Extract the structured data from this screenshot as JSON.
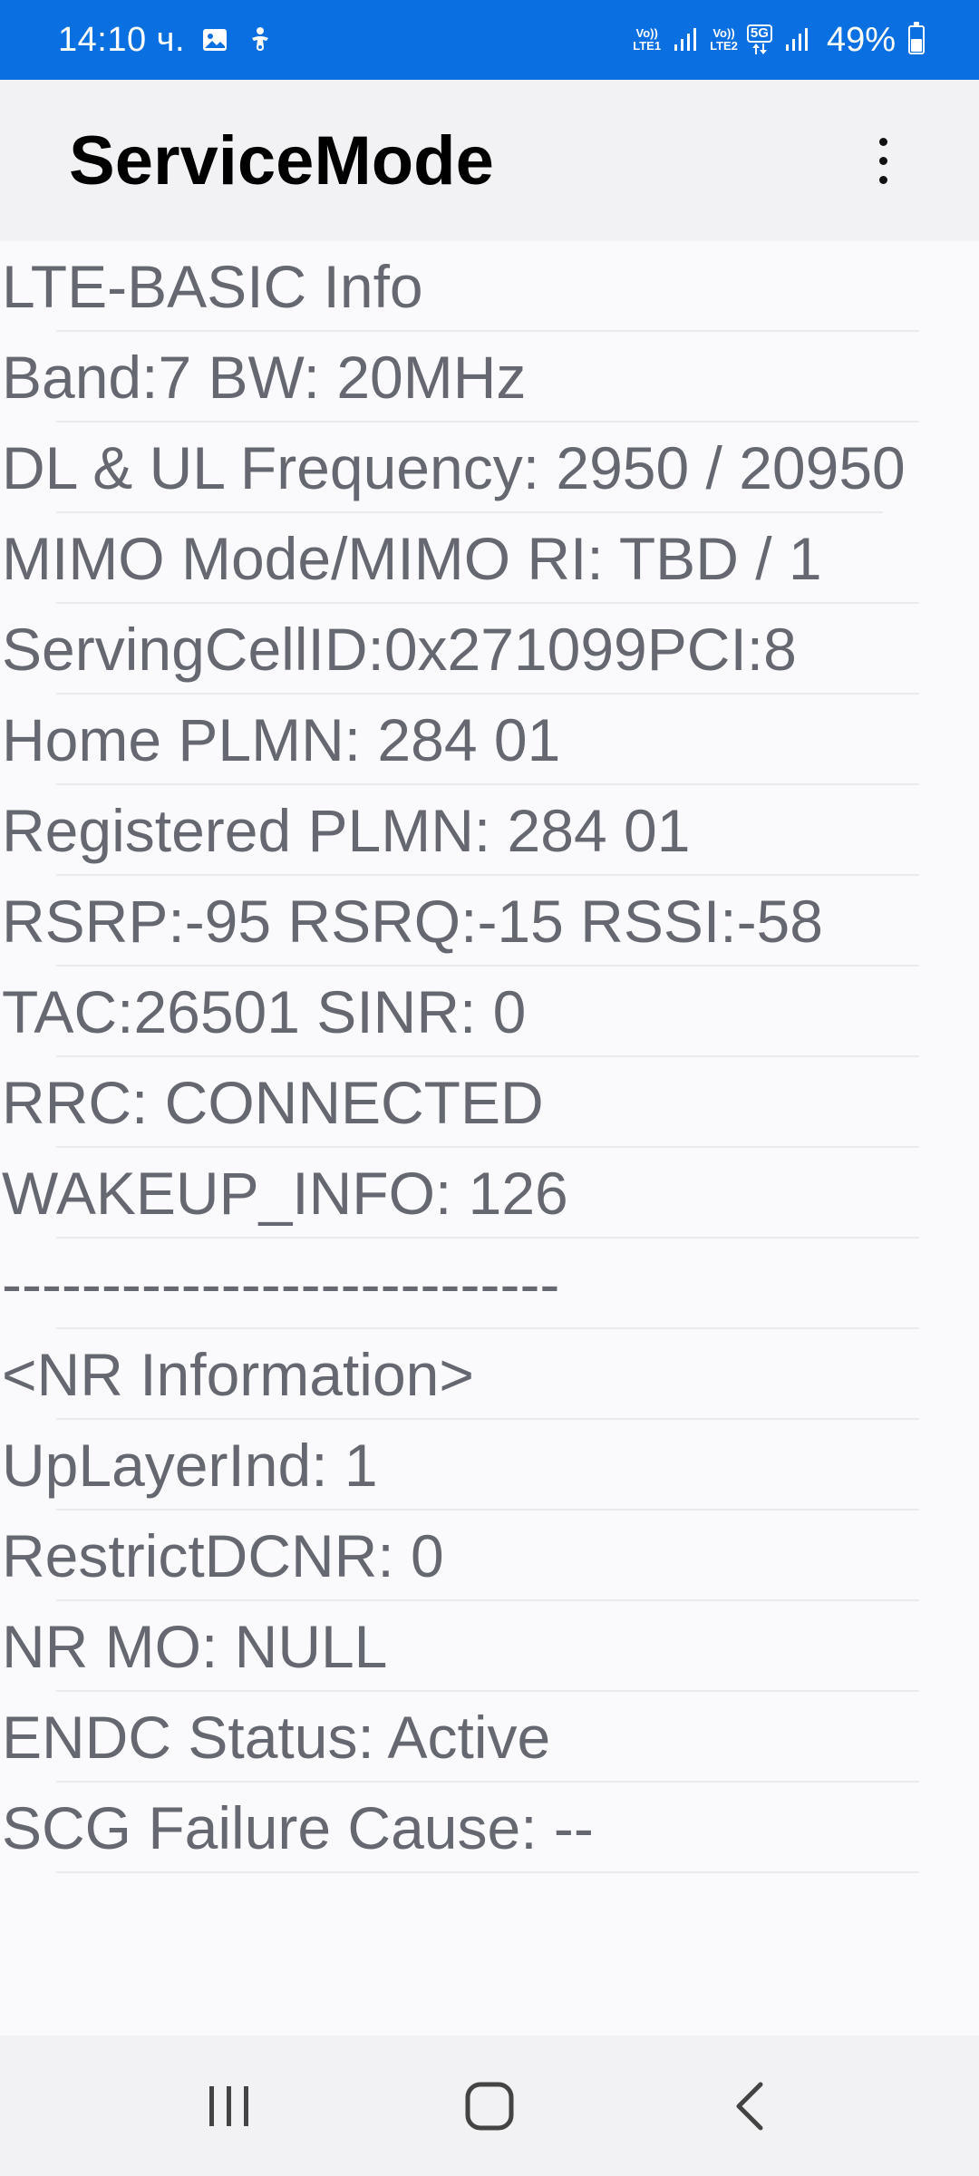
{
  "status_bar": {
    "time": "14:10 ч.",
    "sim1_label_top": "Vo))",
    "sim1_label_bottom": "LTE1",
    "sim2_label_top": "Vo))",
    "sim2_label_bottom": "LTE2",
    "network_badge": "5G",
    "battery_percent": "49%",
    "battery_level": 0.49,
    "icons": [
      "gallery-icon",
      "accessibility-icon",
      "signal-icon",
      "battery-icon"
    ],
    "background_color": "#0a6fe0"
  },
  "app_bar": {
    "title": "ServiceMode",
    "menu_icon": "more-vert-icon"
  },
  "info_lines": [
    "LTE-BASIC Info",
    "Band:7 BW: 20MHz",
    "DL & UL Frequency: 2950 / 20950",
    "MIMO Mode/MIMO RI: TBD / 1",
    "ServingCellID:0x271099PCI:8",
    "Home PLMN: 284 01",
    "Registered PLMN: 284 01",
    "RSRP:-95 RSRQ:-15 RSSI:-58",
    "TAC:26501 SINR: 0",
    "RRC: CONNECTED",
    "WAKEUP_INFO: 126",
    "----------------------------",
    "<NR Information>",
    "UpLayerInd: 1",
    "RestrictDCNR: 0",
    "NR MO: NULL",
    "ENDC Status: Active",
    "SCG Failure Cause: --"
  ],
  "nav_bar": {
    "icons": [
      "recent-apps-icon",
      "home-icon",
      "back-icon"
    ]
  }
}
